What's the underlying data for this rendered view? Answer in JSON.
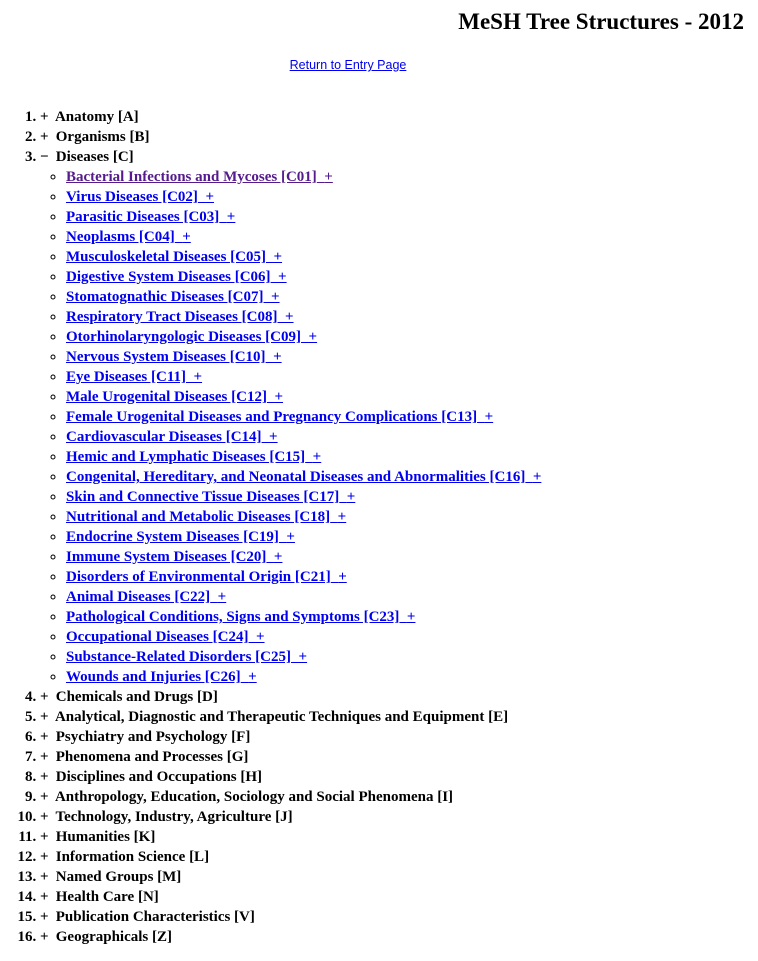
{
  "header": {
    "title": "MeSH Tree Structures - 2012",
    "entry_link_label": "Return to Entry Page"
  },
  "colors": {
    "link": "#0000EE",
    "visited_link": "#551A8B",
    "text": "#000000",
    "background": "#FFFFFF"
  },
  "symbols": {
    "expand": "+",
    "collapse": "−"
  },
  "tree": {
    "items": [
      {
        "number": "1.",
        "toggle": "+",
        "label": "Anatomy [A]"
      },
      {
        "number": "2.",
        "toggle": "+",
        "label": "Organisms [B]"
      },
      {
        "number": "3.",
        "toggle": "−",
        "label": "Diseases [C]",
        "children": [
          {
            "label": "Bacterial Infections and Mycoses [C01]",
            "toggle": "+",
            "visited": true
          },
          {
            "label": "Virus Diseases [C02]",
            "toggle": "+",
            "visited": false
          },
          {
            "label": "Parasitic Diseases [C03]",
            "toggle": "+",
            "visited": false
          },
          {
            "label": "Neoplasms [C04]",
            "toggle": "+",
            "visited": false
          },
          {
            "label": "Musculoskeletal Diseases [C05]",
            "toggle": "+",
            "visited": false
          },
          {
            "label": "Digestive System Diseases [C06]",
            "toggle": "+",
            "visited": false
          },
          {
            "label": "Stomatognathic Diseases [C07]",
            "toggle": "+",
            "visited": false
          },
          {
            "label": "Respiratory Tract Diseases [C08]",
            "toggle": "+",
            "visited": false
          },
          {
            "label": "Otorhinolaryngologic Diseases [C09]",
            "toggle": "+",
            "visited": false
          },
          {
            "label": "Nervous System Diseases [C10]",
            "toggle": "+",
            "visited": false
          },
          {
            "label": "Eye Diseases [C11]",
            "toggle": "+",
            "visited": false
          },
          {
            "label": "Male Urogenital Diseases [C12]",
            "toggle": "+",
            "visited": false
          },
          {
            "label": "Female Urogenital Diseases and Pregnancy Complications [C13]",
            "toggle": "+",
            "visited": false
          },
          {
            "label": "Cardiovascular Diseases [C14]",
            "toggle": "+",
            "visited": false
          },
          {
            "label": "Hemic and Lymphatic Diseases [C15]",
            "toggle": "+",
            "visited": false
          },
          {
            "label": "Congenital, Hereditary, and Neonatal Diseases and Abnormalities [C16]",
            "toggle": "+",
            "visited": false
          },
          {
            "label": "Skin and Connective Tissue Diseases [C17]",
            "toggle": "+",
            "visited": false
          },
          {
            "label": "Nutritional and Metabolic Diseases [C18]",
            "toggle": "+",
            "visited": false
          },
          {
            "label": "Endocrine System Diseases [C19]",
            "toggle": "+",
            "visited": false
          },
          {
            "label": "Immune System Diseases [C20]",
            "toggle": "+",
            "visited": false
          },
          {
            "label": "Disorders of Environmental Origin [C21]",
            "toggle": "+",
            "visited": false
          },
          {
            "label": "Animal Diseases [C22]",
            "toggle": "+",
            "visited": false
          },
          {
            "label": "Pathological Conditions, Signs and Symptoms [C23]",
            "toggle": "+",
            "visited": false
          },
          {
            "label": "Occupational Diseases [C24]",
            "toggle": "+",
            "visited": false
          },
          {
            "label": "Substance-Related Disorders [C25]",
            "toggle": "+",
            "visited": false
          },
          {
            "label": "Wounds and Injuries [C26]",
            "toggle": "+",
            "visited": false
          }
        ]
      },
      {
        "number": "4.",
        "toggle": "+",
        "label": "Chemicals and Drugs [D]"
      },
      {
        "number": "5.",
        "toggle": "+",
        "label": "Analytical, Diagnostic and Therapeutic Techniques and Equipment [E]"
      },
      {
        "number": "6.",
        "toggle": "+",
        "label": "Psychiatry and Psychology [F]"
      },
      {
        "number": "7.",
        "toggle": "+",
        "label": "Phenomena and Processes [G]"
      },
      {
        "number": "8.",
        "toggle": "+",
        "label": "Disciplines and Occupations [H]"
      },
      {
        "number": "9.",
        "toggle": "+",
        "label": "Anthropology, Education, Sociology and Social Phenomena [I]"
      },
      {
        "number": "10.",
        "toggle": "+",
        "label": "Technology, Industry, Agriculture [J]"
      },
      {
        "number": "11.",
        "toggle": "+",
        "label": "Humanities [K]"
      },
      {
        "number": "12.",
        "toggle": "+",
        "label": "Information Science [L]"
      },
      {
        "number": "13.",
        "toggle": "+",
        "label": "Named Groups [M]"
      },
      {
        "number": "14.",
        "toggle": "+",
        "label": "Health Care [N]"
      },
      {
        "number": "15.",
        "toggle": "+",
        "label": "Publication Characteristics [V]"
      },
      {
        "number": "16.",
        "toggle": "+",
        "label": "Geographicals [Z]"
      }
    ]
  }
}
